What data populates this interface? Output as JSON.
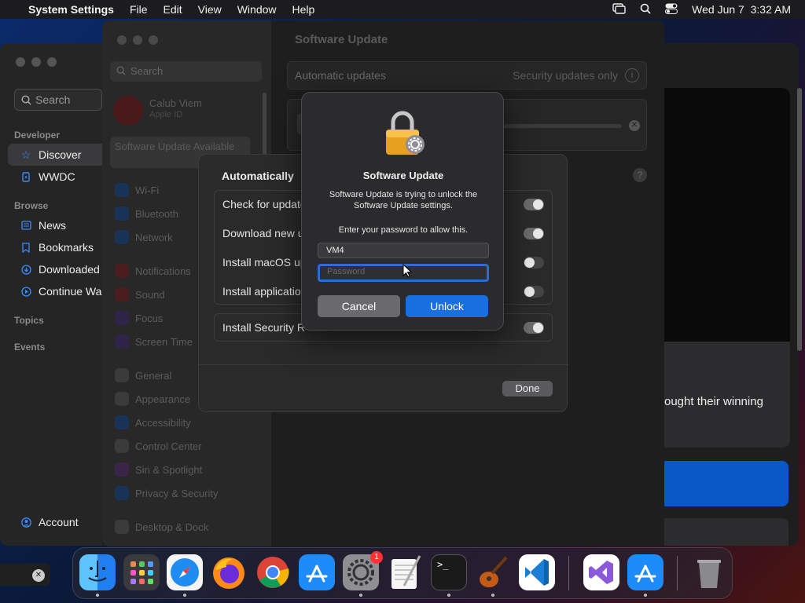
{
  "menubar": {
    "app_name": "System Settings",
    "menus": [
      "File",
      "Edit",
      "View",
      "Window",
      "Help"
    ],
    "clock": "Wed Jun 7  3:32 AM"
  },
  "developer_app": {
    "search_placeholder": "Search",
    "sections": {
      "developer": "Developer",
      "browse": "Browse",
      "topics": "Topics",
      "events": "Events"
    },
    "developer_items": [
      "Discover",
      "WWDC"
    ],
    "browse_items": [
      "News",
      "Bookmarks",
      "Downloaded",
      "Continue Wa"
    ],
    "account": "Account",
    "right_text": "ought their winning"
  },
  "settings": {
    "title": "Software Update",
    "search_placeholder": "Search",
    "user_name": "Calub Viem",
    "user_sub": "Apple ID",
    "update_available": "Software Update Available",
    "sidebar_items": [
      "Wi-Fi",
      "Bluetooth",
      "Network",
      "Notifications",
      "Sound",
      "Focus",
      "Screen Time",
      "General",
      "Appearance",
      "Accessibility",
      "Control Center",
      "Siri & Spotlight",
      "Privacy & Security",
      "Desktop & Dock"
    ],
    "auto_updates_label": "Automatic updates",
    "auto_updates_value": "Security updates only",
    "help": "?"
  },
  "sheet": {
    "title": "Automatically",
    "options": [
      {
        "label": "Check for update",
        "on": true
      },
      {
        "label": "Download new u",
        "on": true
      },
      {
        "label": "Install macOS up",
        "on": false
      },
      {
        "label": "Install application",
        "on": false
      }
    ],
    "security": {
      "label": "Install Security R",
      "on": true
    },
    "done": "Done"
  },
  "dialog": {
    "title": "Software Update",
    "message": "Software Update is trying to unlock the Software Update settings.",
    "prompt": "Enter your password to allow this.",
    "username": "VM4",
    "password_placeholder": "Password",
    "cancel": "Cancel",
    "unlock": "Unlock"
  },
  "dock": {
    "apps": [
      "Finder",
      "Launchpad",
      "Safari",
      "Firefox",
      "Chrome",
      "App Store",
      "System Settings",
      "TextEdit",
      "Terminal",
      "GarageBand",
      "Visual Studio Code",
      "Visual Studio",
      "App Store",
      "Trash"
    ],
    "system_settings_badge": "1"
  }
}
